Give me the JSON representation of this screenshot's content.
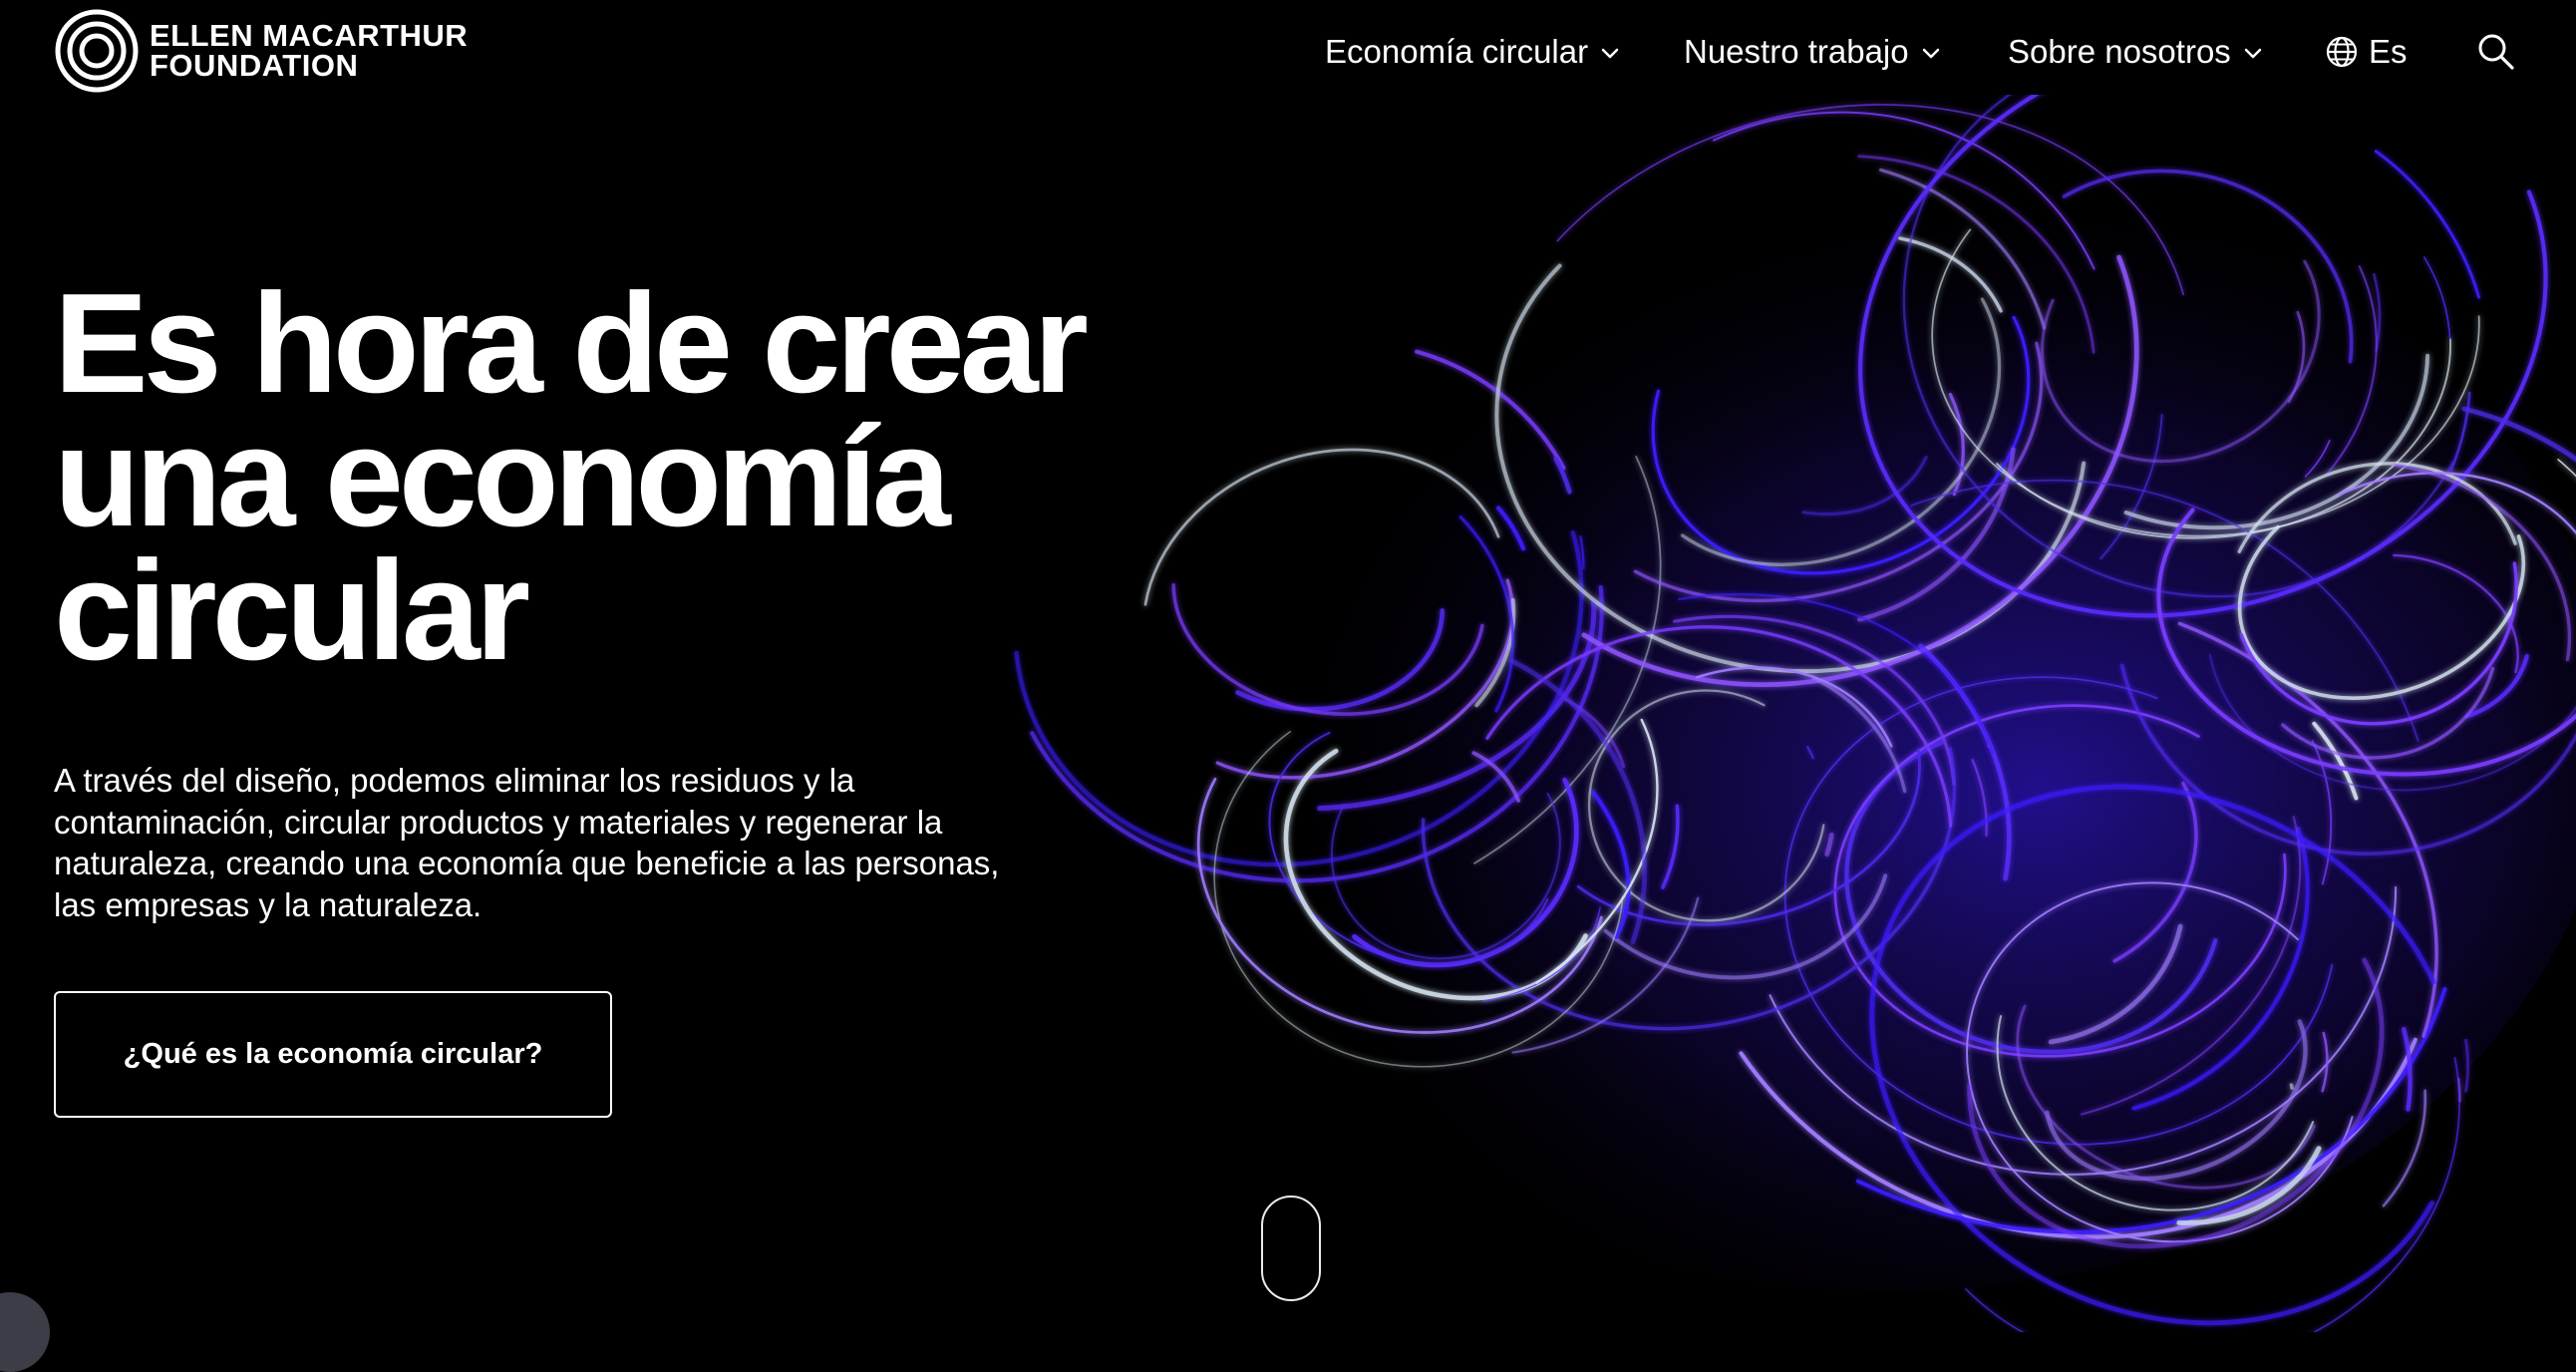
{
  "header": {
    "logo": {
      "line1": "ELLEN MACARTHUR",
      "line2": "FOUNDATION",
      "icon": "concentric-rings-logo"
    },
    "nav": {
      "economia_circular": "Economía circular",
      "nuestro_trabajo": "Nuestro trabajo",
      "sobre_nosotros": "Sobre nosotros",
      "language": "Es",
      "language_icon": "globe-icon",
      "search_icon": "search-icon",
      "dropdown_icon": "chevron-down-icon"
    }
  },
  "hero": {
    "title_lines": [
      "Es hora de crear",
      "una economía",
      "circular"
    ],
    "lead": "A través del diseño, podemos eliminar los residuos y la contaminación, circular productos y materiales y regenerar la naturaleza, creando una economía que beneficie a las personas, las empresas y la naturaleza.",
    "cta_label": "¿Qué es la economía circular?",
    "art": "purple light-trail swirls"
  },
  "colors": {
    "background": "#000000",
    "text": "#ffffff",
    "accent_violet": "#6a2cff",
    "accent_blue": "#3b1dff",
    "trail_highlight": "#d9e6f2"
  }
}
